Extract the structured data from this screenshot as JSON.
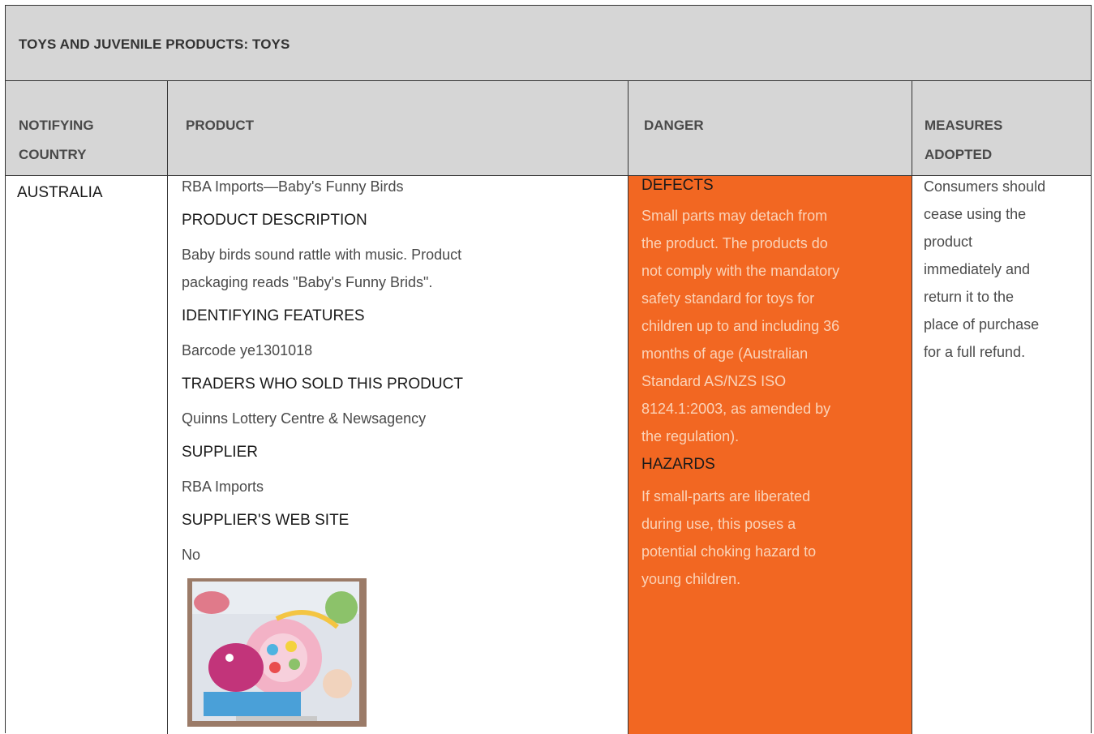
{
  "title": "TOYS AND JUVENILE PRODUCTS: TOYS",
  "headers": {
    "country": [
      "NOTIFYING",
      "COUNTRY"
    ],
    "product": "PRODUCT",
    "danger": "DANGER",
    "measures": [
      "MEASURES",
      "ADOPTED"
    ]
  },
  "row": {
    "country": "AUSTRALIA",
    "product": {
      "name": "RBA Imports—Baby's Funny Birds",
      "desc_heading": "PRODUCT DESCRIPTION",
      "desc_lines": [
        "Baby birds sound rattle with music. Product",
        "packaging reads \"Baby's Funny Brids\"."
      ],
      "features_heading": "IDENTIFYING FEATURES",
      "features": "Barcode ye1301018",
      "traders_heading": "TRADERS WHO SOLD THIS PRODUCT",
      "traders": "Quinns Lottery Centre & Newsagency",
      "supplier_heading": "SUPPLIER",
      "supplier": "RBA Imports",
      "website_heading": "SUPPLIER'S WEB SITE",
      "website": "No"
    },
    "danger": {
      "defects_heading": "DEFECTS",
      "defects_lines": [
        "Small parts may detach from",
        "the product. The products do",
        "not comply with the mandatory",
        "safety standard for toys for",
        "children up to and including 36",
        "months of age (Australian",
        "Standard AS/NZS ISO",
        "8124.1:2003, as amended by",
        "the regulation)."
      ],
      "hazards_heading": "HAZARDS",
      "hazards_lines": [
        "If small-parts are liberated",
        "during use, this poses a",
        "potential choking hazard to",
        "young children."
      ]
    },
    "measures_lines": [
      "Consumers should",
      "cease using the",
      "product",
      "immediately and",
      "return it to the",
      "place of purchase",
      "for a full refund."
    ]
  },
  "colors": {
    "header_bg": "#d6d6d6",
    "danger_bg": "#f26722",
    "danger_text": "#fbd3b8"
  }
}
